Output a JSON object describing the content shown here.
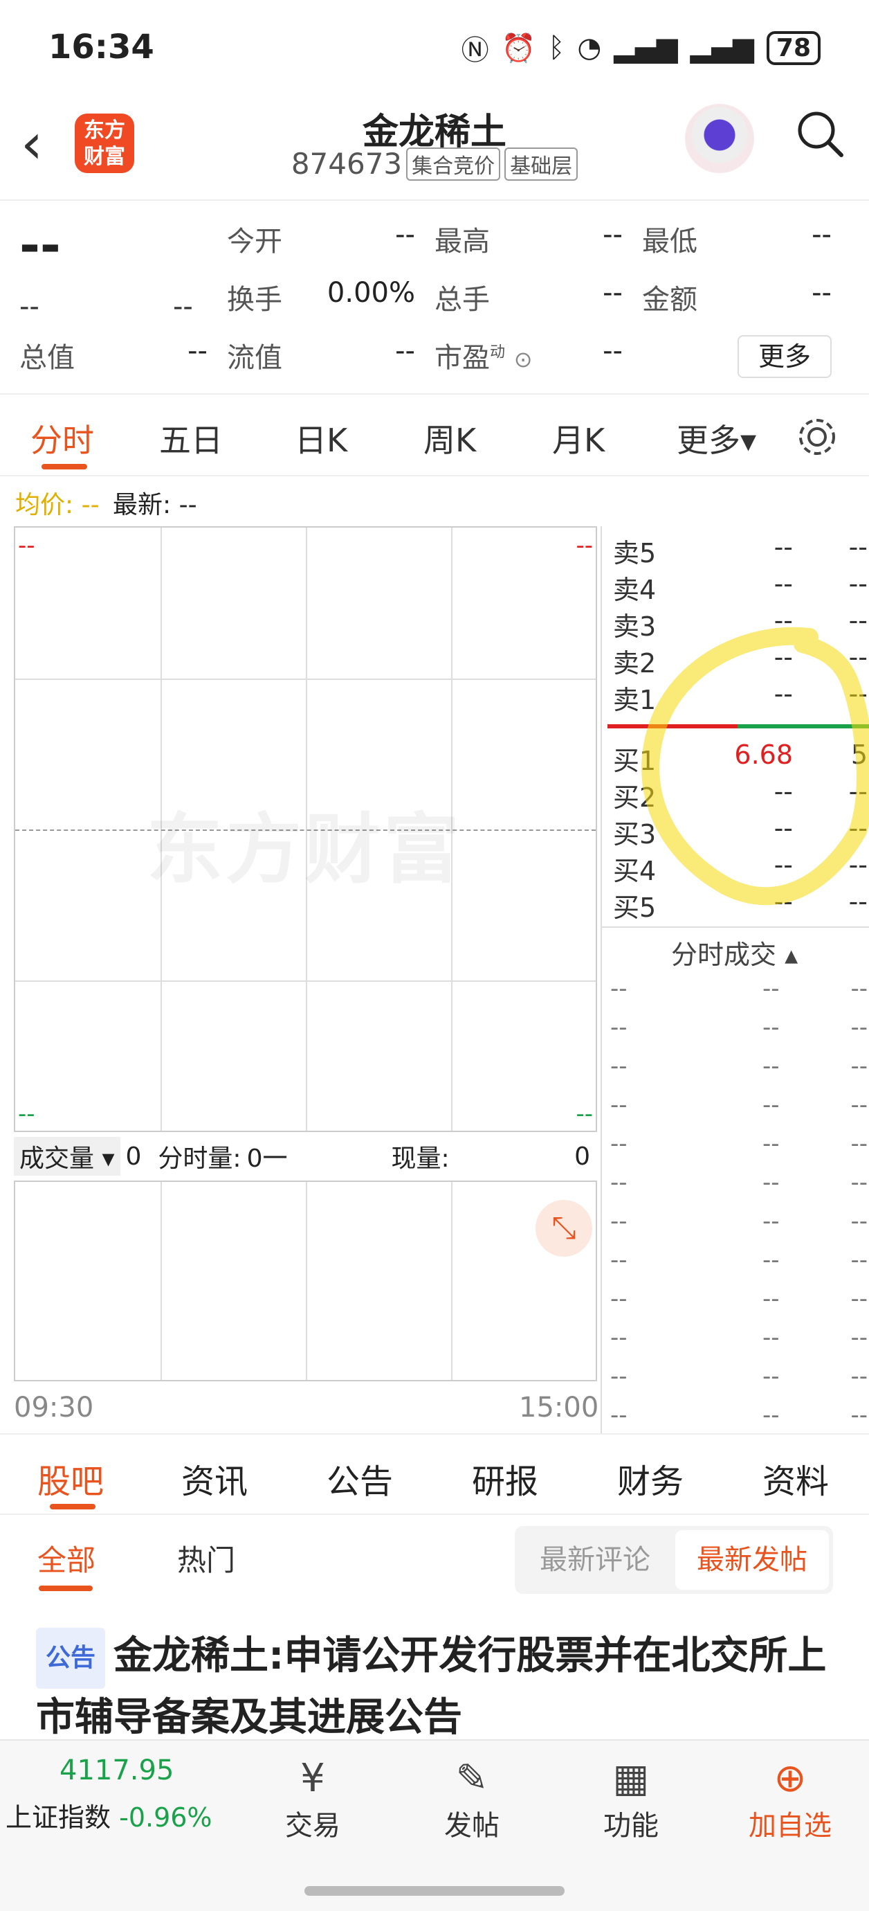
{
  "status_bar": {
    "time": "16:34",
    "icons": [
      "nfc-icon",
      "alarm-icon",
      "bluetooth-icon",
      "wifi-6-icon",
      "5g-signal-icon",
      "5g-signal-icon"
    ],
    "battery": "78"
  },
  "header": {
    "back": "‹",
    "logo_line1": "东方",
    "logo_line2": "财富",
    "title": "金龙稀土",
    "code": "874673",
    "tag1": "集合竞价",
    "tag2": "基础层"
  },
  "quote": {
    "price": "--",
    "change": "--",
    "change_pct": "--",
    "rows": [
      [
        {
          "label": "今开",
          "value": "--"
        },
        {
          "label": "最高",
          "value": "--"
        },
        {
          "label": "最低",
          "value": "--"
        }
      ],
      [
        {
          "label": "换手",
          "value": "0.00%"
        },
        {
          "label": "总手",
          "value": "--"
        },
        {
          "label": "金额",
          "value": "--"
        }
      ]
    ],
    "total_value_label": "总值",
    "total_value": "--",
    "float_value_label": "流值",
    "float_value": "--",
    "pe_label": "市盈",
    "pe_sup": "动",
    "pe_value": "--",
    "more": "更多"
  },
  "chart_tabs": [
    "分时",
    "五日",
    "日K",
    "周K",
    "月K",
    "更多▾"
  ],
  "chart_legend": {
    "avg_label": "均价:",
    "avg_value": "--",
    "latest_label": "最新:",
    "latest_value": "--"
  },
  "chart": {
    "top_left": "--",
    "top_right": "--",
    "bottom_left": "--",
    "bottom_right": "--",
    "watermark": "东方财富",
    "time_start": "09:30",
    "time_end": "15:00"
  },
  "volume_bar": {
    "selector": "成交量 ▾",
    "value": "0",
    "minute_label": "分时量:",
    "minute_value": "0一",
    "current_label": "现量:",
    "current_value": "0"
  },
  "order_book": {
    "asks": [
      {
        "label": "卖5",
        "price": "--",
        "vol": "--"
      },
      {
        "label": "卖4",
        "price": "--",
        "vol": "--"
      },
      {
        "label": "卖3",
        "price": "--",
        "vol": "--"
      },
      {
        "label": "卖2",
        "price": "--",
        "vol": "--"
      },
      {
        "label": "卖1",
        "price": "--",
        "vol": "--"
      }
    ],
    "bids": [
      {
        "label": "买1",
        "price": "6.68",
        "vol": "5"
      },
      {
        "label": "买2",
        "price": "--",
        "vol": "--"
      },
      {
        "label": "买3",
        "price": "--",
        "vol": "--"
      },
      {
        "label": "买4",
        "price": "--",
        "vol": "--"
      },
      {
        "label": "买5",
        "price": "--",
        "vol": "--"
      }
    ],
    "ticks_title": "分时成交 ▴",
    "ticks": [
      "--",
      "--",
      "--",
      "--",
      "--",
      "--",
      "--",
      "--",
      "--",
      "--",
      "--",
      "--"
    ]
  },
  "bottom_tabs": [
    "股吧",
    "资讯",
    "公告",
    "研报",
    "财务",
    "资料"
  ],
  "sub_tabs": {
    "all": "全部",
    "hot": "热门",
    "latest_comment": "最新评论",
    "latest_post": "最新发帖"
  },
  "news": {
    "tag": "公告",
    "title": "金龙稀土:申请公开发行股票并在北交所上市辅导备案及其进展公告"
  },
  "bottom_nav": {
    "index_value": "4117.95",
    "index_name": "上证指数",
    "index_change": "-0.96%",
    "items": [
      {
        "icon": "¥",
        "label": "交易"
      },
      {
        "icon": "✎",
        "label": "发帖"
      },
      {
        "icon": "▦",
        "label": "功能"
      },
      {
        "icon": "⊕",
        "label": "加自选"
      }
    ]
  },
  "colors": {
    "accent": "#e8531e",
    "up": "#e02020",
    "down": "#1aa24a",
    "highlight": "#f5d90a"
  }
}
